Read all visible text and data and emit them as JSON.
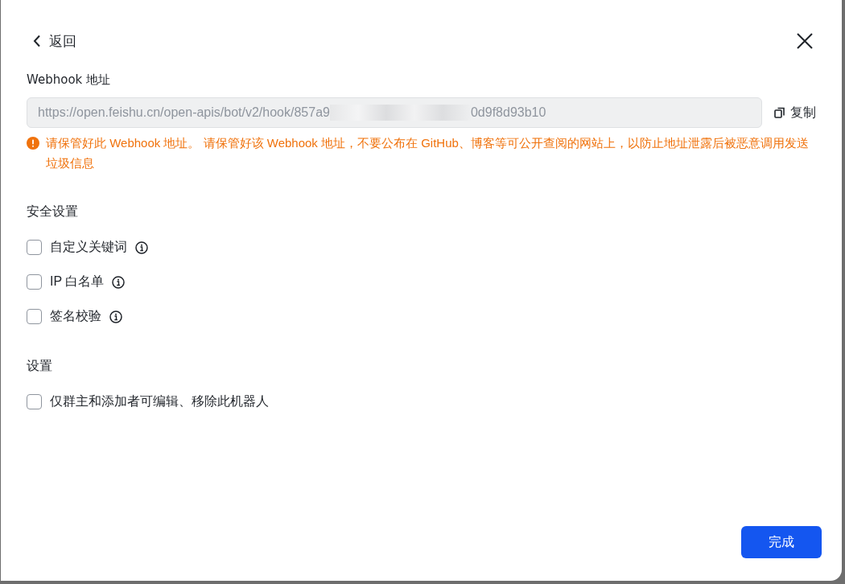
{
  "header": {
    "back_label": "返回"
  },
  "webhook": {
    "label": "Webhook 地址",
    "value_start": "https://open.feishu.cn/open-apis/bot/v2/hook/857a9",
    "value_end": "0d9f8d93b10",
    "copy_label": "复制",
    "warning": "请保管好此 Webhook 地址。 请保管好该 Webhook 地址，不要公布在 GitHub、博客等可公开查阅的网站上，以防止地址泄露后被恶意调用发送垃圾信息"
  },
  "sections": [
    {
      "title": "安全设置",
      "options": [
        {
          "label": "自定义关键词",
          "checked": false,
          "info": true
        },
        {
          "label": "IP 白名单",
          "checked": false,
          "info": true
        },
        {
          "label": "签名校验",
          "checked": false,
          "info": true
        }
      ]
    },
    {
      "title": "设置",
      "options": [
        {
          "label": "仅群主和添加者可编辑、移除此机器人",
          "checked": false,
          "info": false
        }
      ]
    }
  ],
  "footer": {
    "done_label": "完成"
  }
}
